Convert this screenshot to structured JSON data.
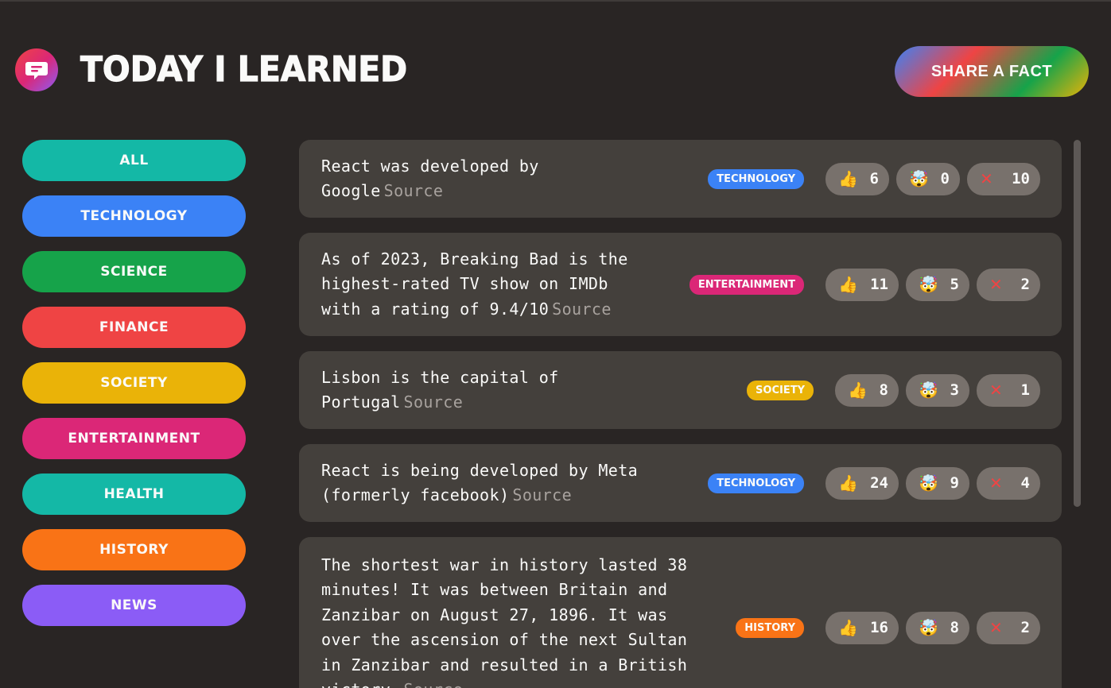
{
  "header": {
    "title": "Today I Learned",
    "share_label": "Share a fact"
  },
  "colors": {
    "background": "#292524",
    "card": "#44403c",
    "vote_button": "#78716c"
  },
  "categories": [
    {
      "label": "All",
      "color": "#14b8a6"
    },
    {
      "label": "technology",
      "color": "#3b82f6"
    },
    {
      "label": "science",
      "color": "#16a34a"
    },
    {
      "label": "finance",
      "color": "#ef4444"
    },
    {
      "label": "society",
      "color": "#eab308"
    },
    {
      "label": "entertainment",
      "color": "#db2777"
    },
    {
      "label": "health",
      "color": "#14b8a6"
    },
    {
      "label": "history",
      "color": "#f97316"
    },
    {
      "label": "news",
      "color": "#8b5cf6"
    }
  ],
  "facts": [
    {
      "text": "React was developed by Google",
      "source": "Source",
      "category": "technology",
      "category_color": "#3b82f6",
      "votes": {
        "interesting": "6",
        "mindblowing": "0",
        "false": "10"
      }
    },
    {
      "text": "As of 2023, Breaking Bad is the highest-rated TV show on IMDb with a rating of 9.4/10",
      "source": "Source",
      "category": "entertainment",
      "category_color": "#db2777",
      "votes": {
        "interesting": "11",
        "mindblowing": "5",
        "false": "2"
      }
    },
    {
      "text": "Lisbon is the capital of Portugal",
      "source": "Source",
      "category": "society",
      "category_color": "#eab308",
      "votes": {
        "interesting": "8",
        "mindblowing": "3",
        "false": "1"
      }
    },
    {
      "text": "React is being developed by Meta (formerly facebook)",
      "source": "Source",
      "category": "technology",
      "category_color": "#3b82f6",
      "votes": {
        "interesting": "24",
        "mindblowing": "9",
        "false": "4"
      }
    },
    {
      "text": "The shortest war in history lasted 38 minutes! It was between Britain and Zanzibar on August 27, 1896. It was over the ascension of the next Sultan in Zanzibar and resulted in a British victory.",
      "source": "Source",
      "category": "history",
      "category_color": "#f97316",
      "votes": {
        "interesting": "16",
        "mindblowing": "8",
        "false": "2"
      }
    }
  ],
  "icons": {
    "logo": "message-bubble-icon",
    "interesting": "thumbs-up-icon",
    "mindblowing": "exploding-head-icon",
    "false": "cross-mark-icon"
  }
}
